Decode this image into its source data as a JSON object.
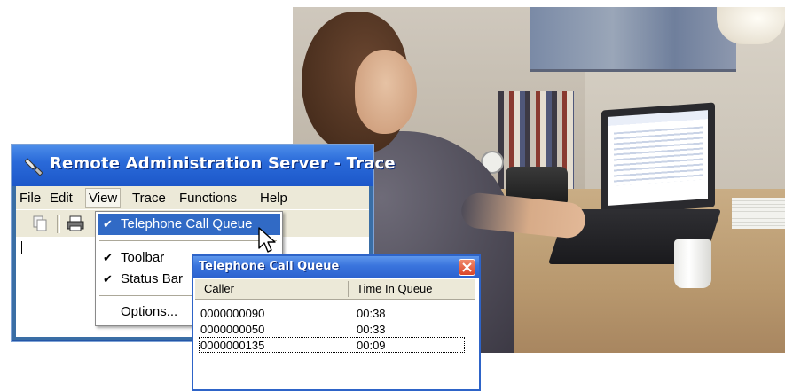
{
  "window": {
    "title": "Remote Administration Server - Trace",
    "menu": [
      "File",
      "Edit",
      "View",
      "Trace",
      "Functions",
      "Help"
    ],
    "active_menu": "View",
    "toolbar_icons": [
      "copy-icon",
      "print-icon"
    ]
  },
  "view_menu": {
    "items": [
      {
        "label": "Telephone Call Queue",
        "checked": true,
        "highlighted": true
      },
      {
        "label": "Toolbar",
        "checked": true,
        "highlighted": false
      },
      {
        "label": "Status Bar",
        "checked": true,
        "highlighted": false
      },
      {
        "label": "Options...",
        "checked": false,
        "highlighted": false
      }
    ]
  },
  "queue_dialog": {
    "title": "Telephone Call Queue",
    "columns": [
      "Caller",
      "Time In Queue"
    ],
    "rows": [
      {
        "caller": "0000000090",
        "time": "00:38"
      },
      {
        "caller": "0000000050",
        "time": "00:33"
      },
      {
        "caller": "0000000135",
        "time": "00:09"
      }
    ]
  },
  "colors": {
    "titlebar": "#2a6ad9",
    "menu_bg": "#ece9d8",
    "selection": "#316ac5",
    "close_button": "#d9452a"
  }
}
